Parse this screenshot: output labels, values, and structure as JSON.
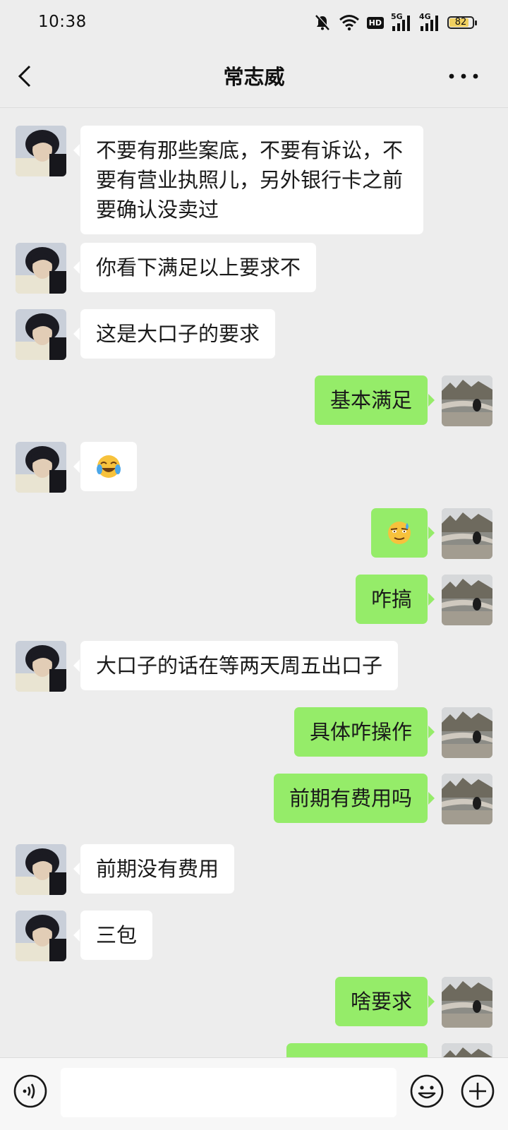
{
  "status_bar": {
    "time": "10:38",
    "icons": [
      "mute-bell-icon",
      "wifi-icon",
      "hd-icon",
      "signal-5g-icon",
      "signal-4g-icon",
      "battery-icon"
    ],
    "hd_label": "HD",
    "net1_label": "5G",
    "net2_label": "4G",
    "battery_level": "82"
  },
  "header": {
    "title": "常志威",
    "back_icon": "chevron-left-icon",
    "more_icon": "more-dots-icon"
  },
  "messages": [
    {
      "side": "left",
      "text": "不要有那些案底，不要有诉讼，不要有营业执照儿，另外银行卡之前要确认没卖过"
    },
    {
      "side": "left",
      "text": "你看下满足以上要求不"
    },
    {
      "side": "left",
      "text": "这是大口子的要求"
    },
    {
      "side": "right",
      "text": "基本满足"
    },
    {
      "side": "left",
      "emoji": "face-tears-of-joy-icon"
    },
    {
      "side": "right",
      "emoji": "face-sweat-smile-icon"
    },
    {
      "side": "right",
      "text": "咋搞"
    },
    {
      "side": "left",
      "text": "大口子的话在等两天周五出口子"
    },
    {
      "side": "right",
      "text": "具体咋操作"
    },
    {
      "side": "right",
      "text": "前期有费用吗"
    },
    {
      "side": "left",
      "text": "前期没有费用"
    },
    {
      "side": "left",
      "text": "三包"
    },
    {
      "side": "right",
      "text": "啥要求"
    }
  ],
  "input_bar": {
    "voice_icon": "voice-icon",
    "emoji_icon": "emoji-icon",
    "plus_icon": "plus-icon",
    "text_value": ""
  },
  "colors": {
    "background": "#ededed",
    "bubble_self": "#95ec69",
    "bubble_other": "#ffffff",
    "input_bar": "#f7f7f7"
  }
}
